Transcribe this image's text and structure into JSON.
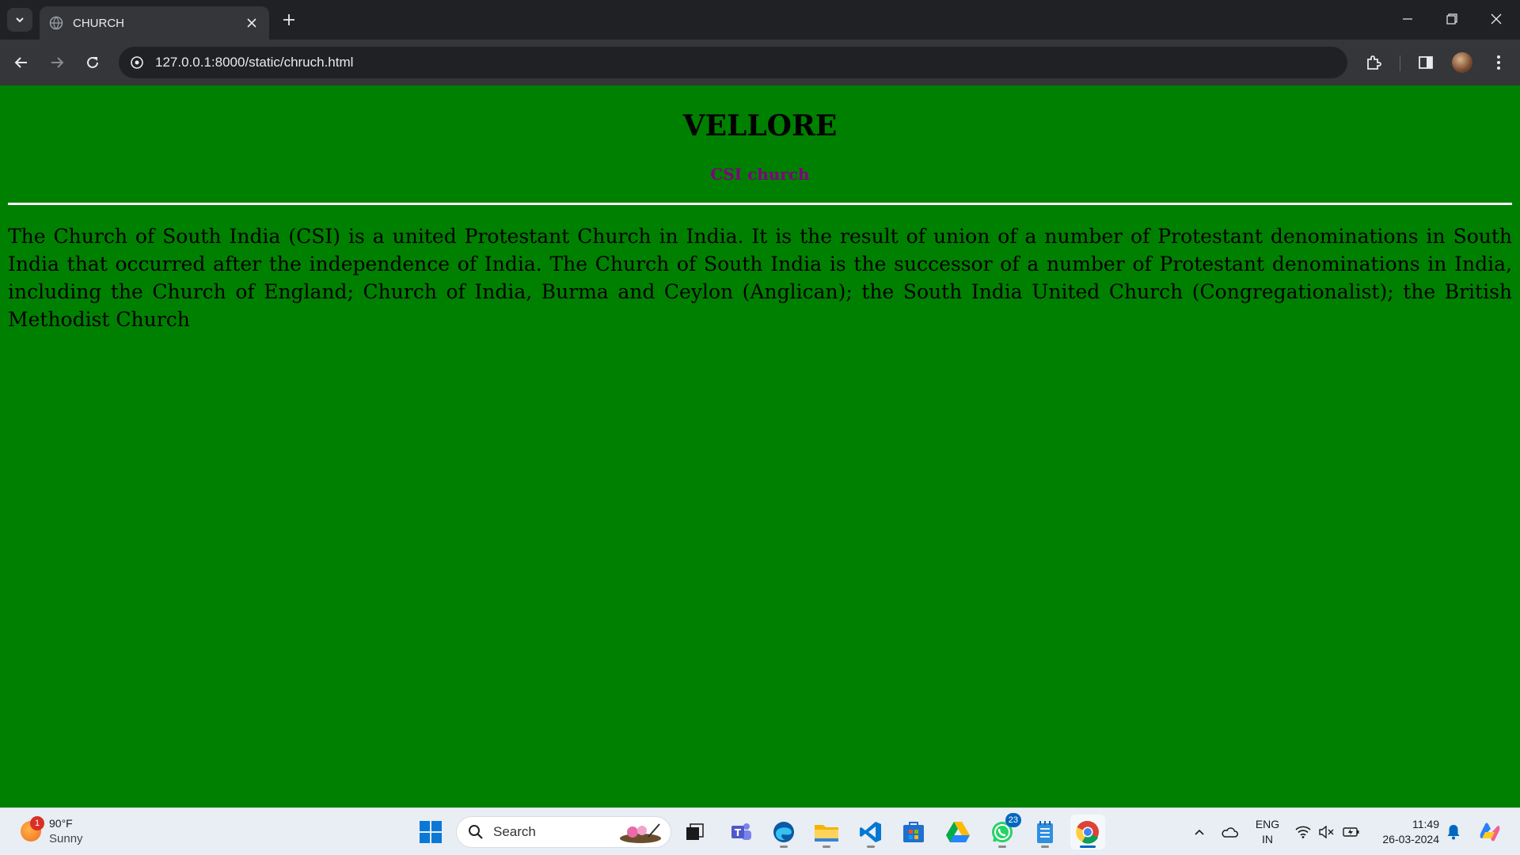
{
  "browser": {
    "tab": {
      "title": "CHURCH"
    },
    "address_bar": {
      "url": "127.0.0.1:8000/static/chruch.html"
    }
  },
  "page": {
    "background_color": "#008000",
    "heading": "VELLORE",
    "subheading": "CSI church",
    "subheading_color": "#800080",
    "paragraph": "The Church of South India (CSI) is a united Protestant Church in India. It is the result of union of a number of Protestant denominations in South India that occurred after the independence of India. The Church of South India is the successor of a number of Protestant denominations in India, including the Church of England; Church of India, Burma and Ceylon (Anglican); the South India United Church (Congregationalist); the British Methodist Church"
  },
  "taskbar": {
    "weather": {
      "badge": "1",
      "temperature": "90°F",
      "condition": "Sunny"
    },
    "search_label": "Search",
    "apps": [
      {
        "name": "start",
        "icon": "windows-logo-icon"
      },
      {
        "name": "task-view",
        "icon": "task-view-icon"
      },
      {
        "name": "teams",
        "icon": "teams-icon"
      },
      {
        "name": "edge",
        "icon": "edge-icon"
      },
      {
        "name": "file-explorer",
        "icon": "folder-icon"
      },
      {
        "name": "vscode",
        "icon": "vscode-icon"
      },
      {
        "name": "store",
        "icon": "store-icon"
      },
      {
        "name": "google-drive",
        "icon": "drive-icon"
      },
      {
        "name": "whatsapp",
        "icon": "whatsapp-icon",
        "badge": "23"
      },
      {
        "name": "notepad",
        "icon": "notepad-icon"
      },
      {
        "name": "chrome",
        "icon": "chrome-icon",
        "active": true
      }
    ],
    "language": {
      "line1": "ENG",
      "line2": "IN"
    },
    "clock": {
      "time": "11:49",
      "date": "26-03-2024"
    }
  }
}
